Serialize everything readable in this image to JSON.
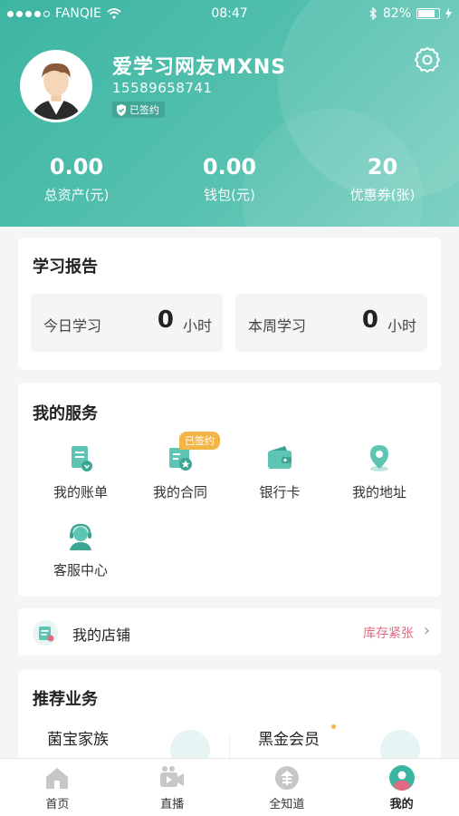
{
  "status_bar": {
    "carrier": "FANQIE",
    "time": "08:47",
    "battery": "82%",
    "battery_level": 0.82
  },
  "profile": {
    "username": "爱学习网友MXNS",
    "phone": "15589658741",
    "signed_badge": "已签约"
  },
  "stats": [
    {
      "value": "0.00",
      "label": "总资产(元)"
    },
    {
      "value": "0.00",
      "label": "钱包(元)"
    },
    {
      "value": "20",
      "label": "优惠券(张)"
    }
  ],
  "report": {
    "title": "学习报告",
    "today": {
      "label": "今日学习",
      "value": "0",
      "unit": "小时"
    },
    "week": {
      "label": "本周学习",
      "value": "0",
      "unit": "小时"
    }
  },
  "services": {
    "title": "我的服务",
    "items": [
      {
        "label": "我的账单",
        "icon": "bill-icon"
      },
      {
        "label": "我的合同",
        "icon": "contract-icon",
        "tag": "已签约"
      },
      {
        "label": "银行卡",
        "icon": "wallet-icon"
      },
      {
        "label": "我的地址",
        "icon": "location-icon"
      },
      {
        "label": "客服中心",
        "icon": "customer-service-icon"
      }
    ]
  },
  "shop": {
    "label": "我的店铺",
    "warning": "库存紧张",
    "chevron": "›"
  },
  "recommend": {
    "title": "推荐业务",
    "items": [
      "菌宝家族",
      "黑金会员"
    ]
  },
  "tabbar": [
    {
      "label": "首页",
      "icon": "home-icon"
    },
    {
      "label": "直播",
      "icon": "live-icon"
    },
    {
      "label": "全知道",
      "icon": "knowledge-icon"
    },
    {
      "label": "我的",
      "icon": "profile-icon",
      "active": true
    }
  ],
  "colors": {
    "accent": "#3cb5a2",
    "warning": "#e26a82",
    "tag": "#f2b54a"
  }
}
